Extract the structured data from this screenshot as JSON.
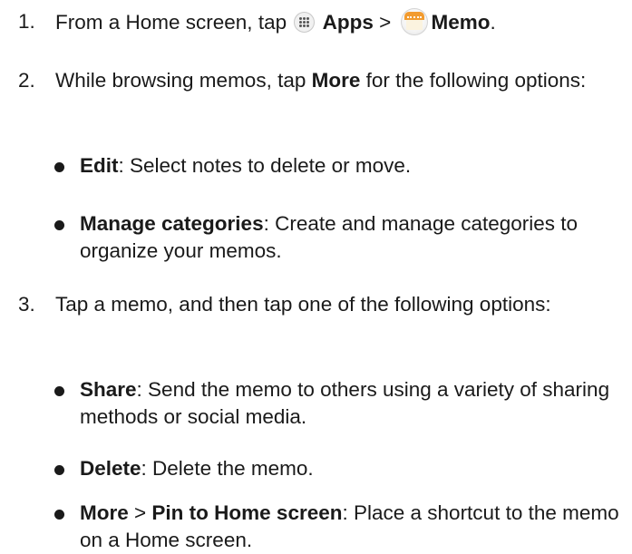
{
  "steps": [
    {
      "number": "1.",
      "prefix": "From a Home screen, tap ",
      "apps_label": "Apps",
      "separator": " > ",
      "memo_label": "Memo",
      "suffix": ".",
      "icons": [
        "apps-icon",
        "memo-icon"
      ]
    },
    {
      "number": "2.",
      "text_before": "While browsing memos, tap ",
      "bold": "More",
      "text_after": " for the following options:",
      "bullets": [
        {
          "term": "Edit",
          "desc": ": Select notes to delete or move."
        },
        {
          "term": "Manage categories",
          "desc": ": Create and manage categories to organize your memos."
        }
      ]
    },
    {
      "number": "3.",
      "text": "Tap a memo, and then tap one of the following options:",
      "bullets": [
        {
          "term": "Share",
          "desc": ": Send the memo to others using a variety of sharing methods or social media."
        },
        {
          "term": "Delete",
          "desc": ": Delete the memo."
        },
        {
          "term": "More",
          "sep": " > ",
          "term2": "Pin to Home screen",
          "desc": ": Place a shortcut to the memo on a Home screen."
        }
      ]
    }
  ],
  "colors": {
    "text": "#1a1a1a",
    "memo_icon_accent": "#f29b2f"
  }
}
